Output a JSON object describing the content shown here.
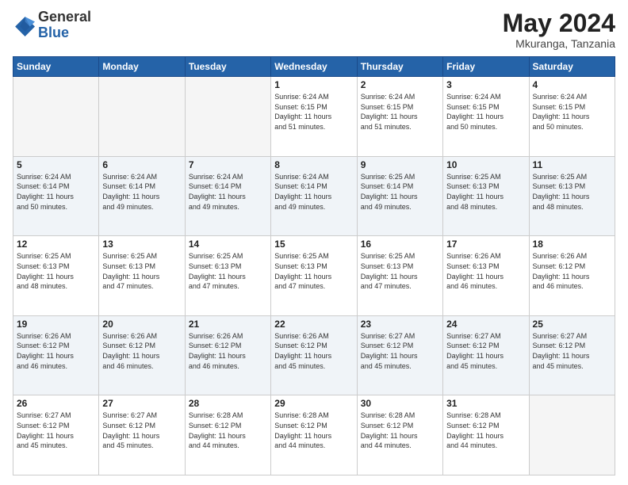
{
  "header": {
    "logo_general": "General",
    "logo_blue": "Blue",
    "month_title": "May 2024",
    "location": "Mkuranga, Tanzania"
  },
  "days_of_week": [
    "Sunday",
    "Monday",
    "Tuesday",
    "Wednesday",
    "Thursday",
    "Friday",
    "Saturday"
  ],
  "weeks": [
    {
      "days": [
        {
          "number": "",
          "info": ""
        },
        {
          "number": "",
          "info": ""
        },
        {
          "number": "",
          "info": ""
        },
        {
          "number": "1",
          "info": "Sunrise: 6:24 AM\nSunset: 6:15 PM\nDaylight: 11 hours\nand 51 minutes."
        },
        {
          "number": "2",
          "info": "Sunrise: 6:24 AM\nSunset: 6:15 PM\nDaylight: 11 hours\nand 51 minutes."
        },
        {
          "number": "3",
          "info": "Sunrise: 6:24 AM\nSunset: 6:15 PM\nDaylight: 11 hours\nand 50 minutes."
        },
        {
          "number": "4",
          "info": "Sunrise: 6:24 AM\nSunset: 6:15 PM\nDaylight: 11 hours\nand 50 minutes."
        }
      ]
    },
    {
      "days": [
        {
          "number": "5",
          "info": "Sunrise: 6:24 AM\nSunset: 6:14 PM\nDaylight: 11 hours\nand 50 minutes."
        },
        {
          "number": "6",
          "info": "Sunrise: 6:24 AM\nSunset: 6:14 PM\nDaylight: 11 hours\nand 49 minutes."
        },
        {
          "number": "7",
          "info": "Sunrise: 6:24 AM\nSunset: 6:14 PM\nDaylight: 11 hours\nand 49 minutes."
        },
        {
          "number": "8",
          "info": "Sunrise: 6:24 AM\nSunset: 6:14 PM\nDaylight: 11 hours\nand 49 minutes."
        },
        {
          "number": "9",
          "info": "Sunrise: 6:25 AM\nSunset: 6:14 PM\nDaylight: 11 hours\nand 49 minutes."
        },
        {
          "number": "10",
          "info": "Sunrise: 6:25 AM\nSunset: 6:13 PM\nDaylight: 11 hours\nand 48 minutes."
        },
        {
          "number": "11",
          "info": "Sunrise: 6:25 AM\nSunset: 6:13 PM\nDaylight: 11 hours\nand 48 minutes."
        }
      ]
    },
    {
      "days": [
        {
          "number": "12",
          "info": "Sunrise: 6:25 AM\nSunset: 6:13 PM\nDaylight: 11 hours\nand 48 minutes."
        },
        {
          "number": "13",
          "info": "Sunrise: 6:25 AM\nSunset: 6:13 PM\nDaylight: 11 hours\nand 47 minutes."
        },
        {
          "number": "14",
          "info": "Sunrise: 6:25 AM\nSunset: 6:13 PM\nDaylight: 11 hours\nand 47 minutes."
        },
        {
          "number": "15",
          "info": "Sunrise: 6:25 AM\nSunset: 6:13 PM\nDaylight: 11 hours\nand 47 minutes."
        },
        {
          "number": "16",
          "info": "Sunrise: 6:25 AM\nSunset: 6:13 PM\nDaylight: 11 hours\nand 47 minutes."
        },
        {
          "number": "17",
          "info": "Sunrise: 6:26 AM\nSunset: 6:13 PM\nDaylight: 11 hours\nand 46 minutes."
        },
        {
          "number": "18",
          "info": "Sunrise: 6:26 AM\nSunset: 6:12 PM\nDaylight: 11 hours\nand 46 minutes."
        }
      ]
    },
    {
      "days": [
        {
          "number": "19",
          "info": "Sunrise: 6:26 AM\nSunset: 6:12 PM\nDaylight: 11 hours\nand 46 minutes."
        },
        {
          "number": "20",
          "info": "Sunrise: 6:26 AM\nSunset: 6:12 PM\nDaylight: 11 hours\nand 46 minutes."
        },
        {
          "number": "21",
          "info": "Sunrise: 6:26 AM\nSunset: 6:12 PM\nDaylight: 11 hours\nand 46 minutes."
        },
        {
          "number": "22",
          "info": "Sunrise: 6:26 AM\nSunset: 6:12 PM\nDaylight: 11 hours\nand 45 minutes."
        },
        {
          "number": "23",
          "info": "Sunrise: 6:27 AM\nSunset: 6:12 PM\nDaylight: 11 hours\nand 45 minutes."
        },
        {
          "number": "24",
          "info": "Sunrise: 6:27 AM\nSunset: 6:12 PM\nDaylight: 11 hours\nand 45 minutes."
        },
        {
          "number": "25",
          "info": "Sunrise: 6:27 AM\nSunset: 6:12 PM\nDaylight: 11 hours\nand 45 minutes."
        }
      ]
    },
    {
      "days": [
        {
          "number": "26",
          "info": "Sunrise: 6:27 AM\nSunset: 6:12 PM\nDaylight: 11 hours\nand 45 minutes."
        },
        {
          "number": "27",
          "info": "Sunrise: 6:27 AM\nSunset: 6:12 PM\nDaylight: 11 hours\nand 45 minutes."
        },
        {
          "number": "28",
          "info": "Sunrise: 6:28 AM\nSunset: 6:12 PM\nDaylight: 11 hours\nand 44 minutes."
        },
        {
          "number": "29",
          "info": "Sunrise: 6:28 AM\nSunset: 6:12 PM\nDaylight: 11 hours\nand 44 minutes."
        },
        {
          "number": "30",
          "info": "Sunrise: 6:28 AM\nSunset: 6:12 PM\nDaylight: 11 hours\nand 44 minutes."
        },
        {
          "number": "31",
          "info": "Sunrise: 6:28 AM\nSunset: 6:12 PM\nDaylight: 11 hours\nand 44 minutes."
        },
        {
          "number": "",
          "info": ""
        }
      ]
    }
  ]
}
